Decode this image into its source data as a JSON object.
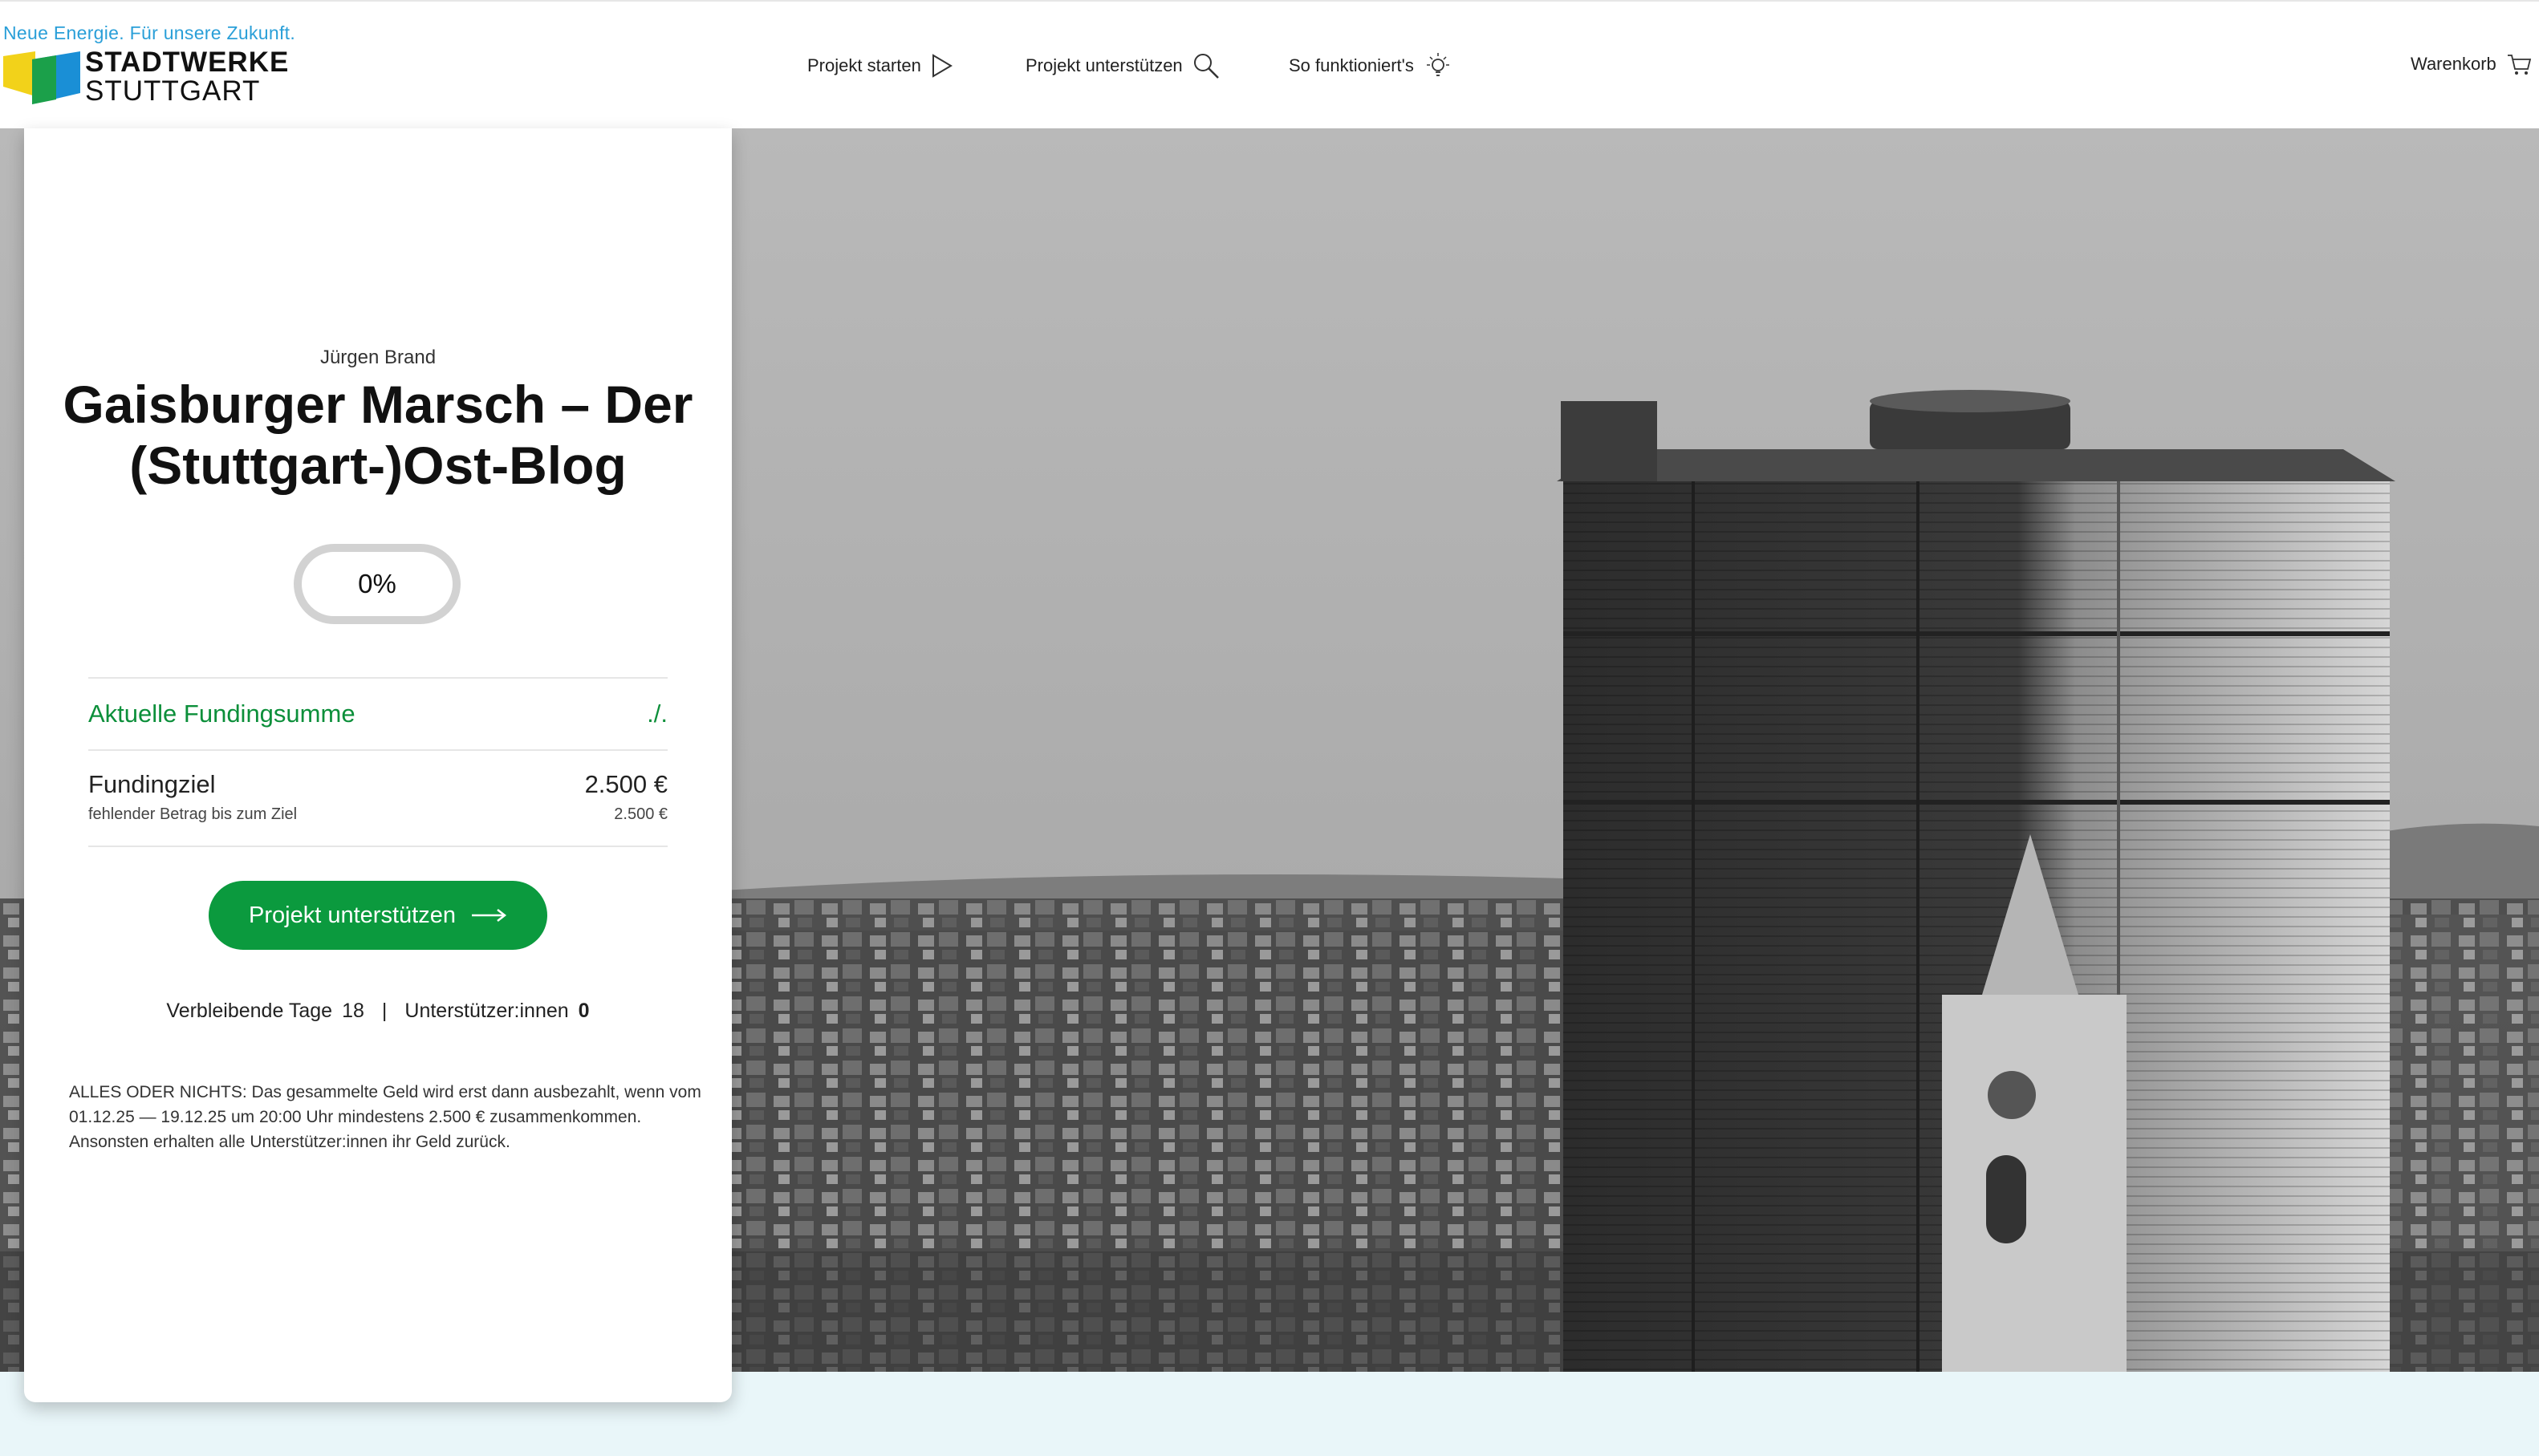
{
  "header": {
    "tagline": "Neue Energie. Für unsere Zukunft.",
    "logo_line1": "STADTWERKE",
    "logo_line2": "STUTTGART",
    "nav": {
      "start": "Projekt starten",
      "support": "Projekt unterstützen",
      "how": "So funktioniert's",
      "cart": "Warenkorb"
    }
  },
  "project": {
    "author": "Jürgen Brand",
    "title": "Gaisburger Marsch – Der (Stuttgart-)Ost-Blog",
    "progress_label": "0%",
    "progress_value": 0,
    "current_funding_label": "Aktuelle Fundingsumme",
    "current_funding_value": "./.",
    "goal_label": "Fundingziel",
    "goal_value": "2.500 €",
    "missing_label": "fehlender Betrag bis zum Ziel",
    "missing_value": "2.500 €",
    "cta_label": "Projekt unterstützen",
    "remaining_days_label": "Verbleibende Tage",
    "remaining_days_value": "18",
    "supporters_label": "Unterstützer:innen",
    "supporters_value": "0",
    "separator": "|",
    "note": "ALLES ODER NICHTS: Das gesammelte Geld wird erst dann ausbezahlt, wenn vom 01.12.25 — 19.12.25 um 20:00 Uhr mindestens 2.500 € zusammenkommen. Ansonsten erhalten alle Unterstützer:innen ihr Geld zurück."
  },
  "colors": {
    "brand_green": "#0b9a3e",
    "accent_blue": "#2a9fd8",
    "logo_yellow": "#f2d21a",
    "logo_blue": "#1a8fd6",
    "logo_green": "#1ba04a",
    "bottom_strip": "#e9f6f9"
  },
  "icons": {
    "start": "play-icon",
    "support": "search-icon",
    "how": "lightbulb-icon",
    "cart": "cart-icon",
    "cta": "arrow-right-icon"
  }
}
